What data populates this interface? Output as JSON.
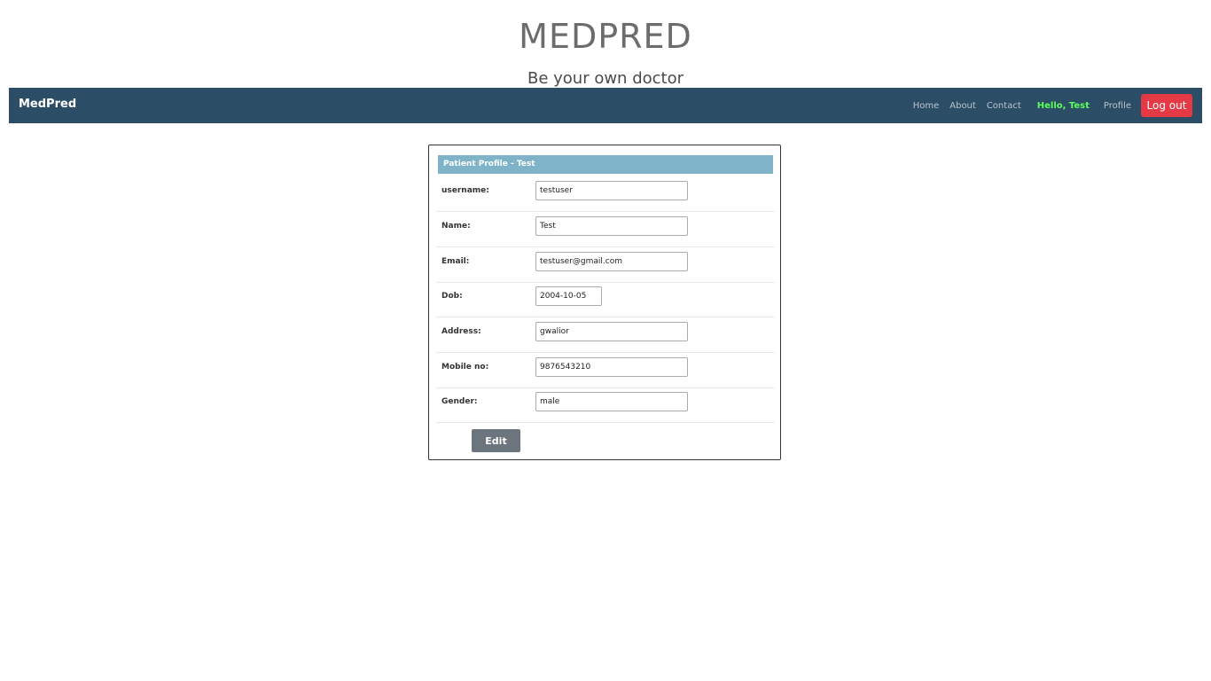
{
  "header": {
    "title": "MEDPRED",
    "tagline": "Be your own doctor"
  },
  "navbar": {
    "brand": "MedPred",
    "links": {
      "home": "Home",
      "about": "About",
      "contact": "Contact",
      "hello": "Hello, Test",
      "profile": "Profile"
    },
    "logout_label": "Log out"
  },
  "profile": {
    "heading": "Patient Profile - Test",
    "fields": {
      "username": {
        "label": "username:",
        "value": "testuser"
      },
      "name": {
        "label": "Name:",
        "value": "Test"
      },
      "email": {
        "label": "Email:",
        "value": "testuser@gmail.com"
      },
      "dob": {
        "label": "Dob:",
        "value": "2004-10-05"
      },
      "address": {
        "label": "Address:",
        "value": "gwalior"
      },
      "mobile": {
        "label": "Mobile no:",
        "value": "9876543210"
      },
      "gender": {
        "label": "Gender:",
        "value": "male"
      }
    },
    "edit_label": "Edit"
  },
  "colors": {
    "navbar_bg": "#2c4d66",
    "card_header_bg": "#7fb3c8",
    "logout_bg": "#e53945",
    "hello_text": "#5bff5b",
    "edit_bg": "#6c757d"
  }
}
